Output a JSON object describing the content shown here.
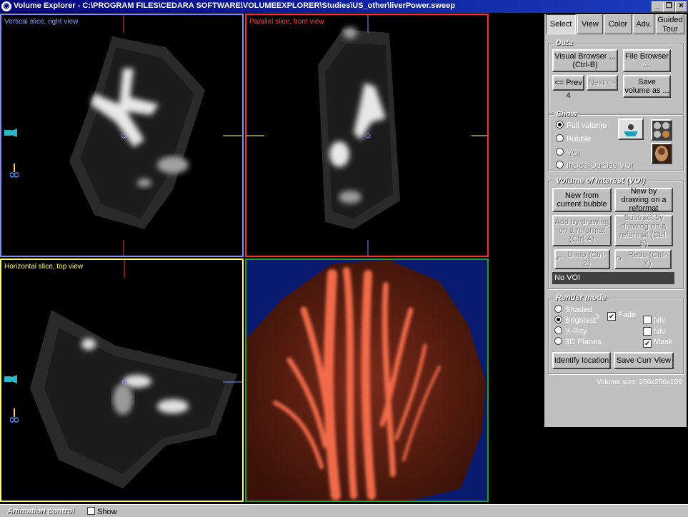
{
  "window": {
    "title": "Volume Explorer - C:\\PROGRAM FILES\\CEDARA SOFTWARE\\VOLUMEEXPLORER\\Studies\\US_other\\liverPower.sweep",
    "minimize_label": "_",
    "maximize_label": "❐",
    "close_label": "✕",
    "accent_color": "#00007c"
  },
  "views": {
    "sagittal": {
      "label": "Vertical slice, right view",
      "border_color": "#7f8cff"
    },
    "coronal": {
      "label": "Parallel slice, front view",
      "border_color": "#ff2a2a"
    },
    "axial": {
      "label": "Horizontal slice, top view",
      "border_color": "#ffff66"
    },
    "render": {
      "label": "",
      "border_color": "#2a9a2a",
      "background": "#0a1a6e",
      "tissue_color": "#e0553a"
    }
  },
  "tabs": [
    {
      "label": "Select",
      "active": true
    },
    {
      "label": "View",
      "active": false
    },
    {
      "label": "Color",
      "active": false
    },
    {
      "label": "Adv.",
      "active": false
    },
    {
      "label": "Guided Tour",
      "active": false
    }
  ],
  "data_group": {
    "title": "Data",
    "visual_browser": "Visual Browser ... (Ctrl-B)",
    "file_browser": "File Browser ...",
    "prev": "<= Prev",
    "next": "Next =>",
    "save_volume": "Save volume as ...",
    "index": "4"
  },
  "show_group": {
    "title": "Show",
    "options": [
      {
        "label": "Full volume",
        "selected": true,
        "enabled": true
      },
      {
        "label": "Bubble",
        "selected": false,
        "enabled": true
      },
      {
        "label": "VOI",
        "selected": false,
        "enabled": false
      },
      {
        "label": "Inside-Outside VOI",
        "selected": false,
        "enabled": false
      }
    ]
  },
  "voi_group": {
    "title": "Volume of Interest (VOI)",
    "new_from_bubble": "New from current bubble",
    "new_by_drawing": "New by drawing on a reformat",
    "add_by_drawing": "Add by drawing on a reformat (Ctrl-A)",
    "subtract_by_drawing": "Subtract by drawing on a reformat (Ctrl-S)",
    "undo": "Undo (Ctrl-Z)",
    "redo": "Redo (Ctrl-Y)",
    "status": "No VOI"
  },
  "render_group": {
    "title": "Render mode",
    "modes": [
      {
        "label": "Shaded",
        "selected": false
      },
      {
        "label": "Brightest",
        "selected": true
      },
      {
        "label": "X-Ray",
        "selected": false
      },
      {
        "label": "3D Planes",
        "selected": false
      }
    ],
    "fade": {
      "label": "Fade",
      "checked": true
    },
    "nn1": {
      "label": "NN",
      "checked": false
    },
    "nn2": {
      "label": "NN",
      "checked": false
    },
    "mask": {
      "label": "Mask",
      "checked": true
    },
    "identify": "Identify location",
    "save_cur_view": "Save Curr View"
  },
  "volume_size": "Volume size: 256x256x159",
  "status_bar": {
    "animation_control": "Animation control",
    "show_label": "Show",
    "show_checked": false
  }
}
